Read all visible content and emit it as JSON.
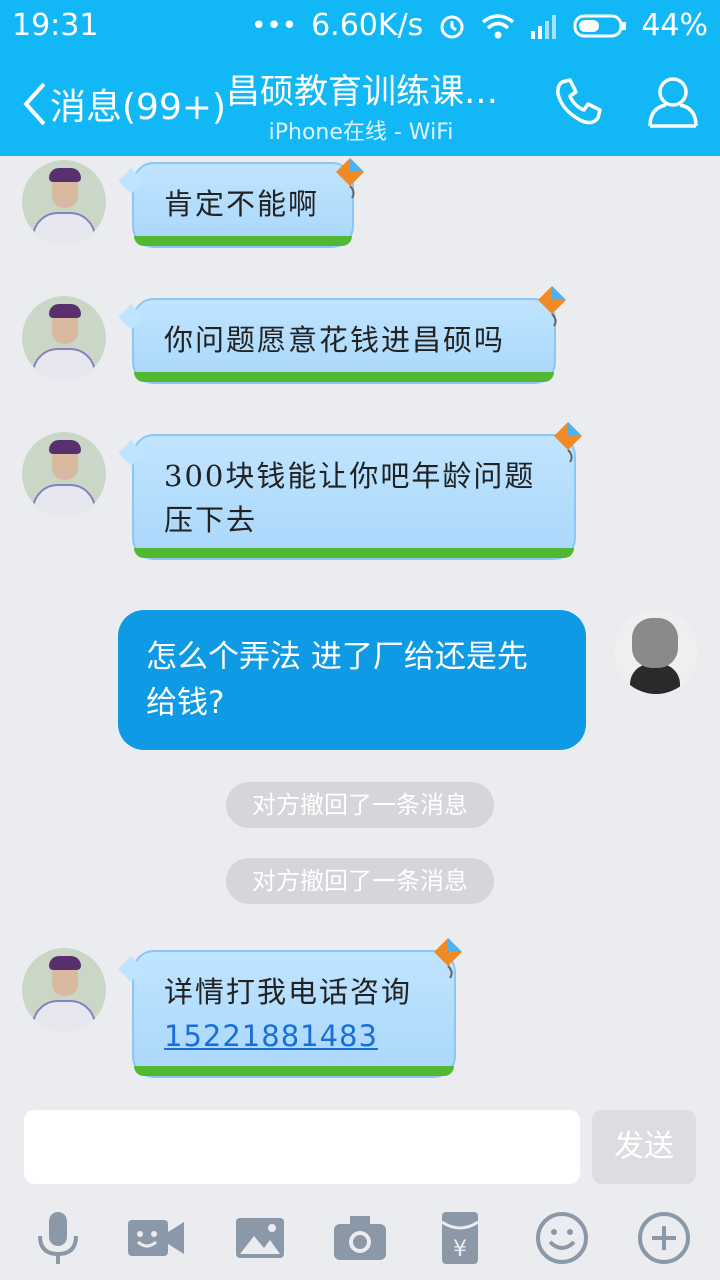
{
  "status": {
    "time": "19:31",
    "net_speed": "6.60K/s",
    "battery": "44%"
  },
  "header": {
    "back_label": "消息(99+)",
    "title": "昌硕教育训练课…",
    "subtitle": "iPhone在线 - WiFi"
  },
  "messages": [
    {
      "from": "them",
      "text": "肯定不能啊"
    },
    {
      "from": "them",
      "text": "你问题愿意花钱进昌硕吗"
    },
    {
      "from": "them",
      "text_line1": "300块钱能让你吧年龄问题",
      "text_line2": "压下去"
    },
    {
      "from": "me",
      "text_line1": "怎么个弄法 进了厂给还是先",
      "text_line2": "给钱?"
    },
    {
      "notice": "对方撤回了一条消息"
    },
    {
      "notice": "对方撤回了一条消息"
    },
    {
      "from": "them",
      "text": "详情打我电话咨询",
      "phone": "15221881483"
    }
  ],
  "composer": {
    "placeholder": "",
    "send_label": "发送"
  },
  "icons": [
    "microphone-icon",
    "video-icon",
    "image-icon",
    "camera-icon",
    "red-packet-icon",
    "emoji-icon",
    "plus-icon"
  ],
  "colors": {
    "accent": "#12b7f5",
    "out_bubble": "#0f9ae6",
    "in_bubble": "#bfe4ff"
  }
}
